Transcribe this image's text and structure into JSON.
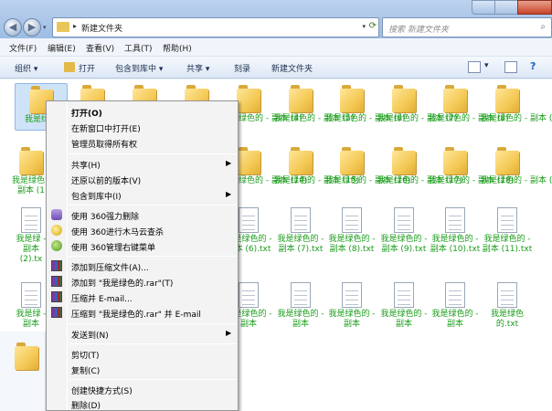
{
  "address": {
    "path": "新建文件夹",
    "search_placeholder": "搜索 新建文件夹"
  },
  "menubar": [
    "文件(F)",
    "编辑(E)",
    "查看(V)",
    "工具(T)",
    "帮助(H)"
  ],
  "toolbar": {
    "organize": "组织 ▾",
    "open": "打开",
    "include": "包含到库中 ▾",
    "share": "共享 ▾",
    "burn": "刻录",
    "new_folder": "新建文件夹"
  },
  "files": {
    "row1_folders": [
      "我是绿色",
      "我是绿色的 - 副本 (4)",
      "我是绿色的 - 副本 (5)",
      "我是绿色的 - 副本 (6)",
      "我是绿色的 - 副本 (7)",
      "我是绿色的 - 副本 (8)",
      "我是绿色的 - 副本 (9)"
    ],
    "row2_folders": [
      "我是绿色 - 副本 (1",
      "我是绿色的 - 副本 (14)",
      "我是绿色的 - 副本 (15)",
      "我是绿色的 - 副本 (16)",
      "我是绿色的 - 副本 (17)",
      "我是绿色的 - 副本 (18)",
      "我是绿色的 - 副本 (19)"
    ],
    "row3_txt": [
      "我是绿 - 副本 (2).tx",
      "我是绿色的 - 副本 (6).txt",
      "我是绿色的 - 副本 (7).txt",
      "我是绿色的 - 副本 (8).txt",
      "我是绿色的 - 副本 (9).txt",
      "我是绿色的 - 副本 (10).txt",
      "我是绿色的 - 副本 (11).txt"
    ],
    "row4_txt": [
      "我是绿 - 副本",
      "我是绿色的 - 副本",
      "我是绿色的 - 副本",
      "我是绿色的 - 副本",
      "我是绿色的 - 副本",
      "我是绿色的 - 副本",
      "我是绿色 的.txt"
    ]
  },
  "context_menu": {
    "open": "打开(O)",
    "open_new_window": "在新窗口中打开(E)",
    "take_ownership": "管理员取得所有权",
    "share": "共享(H)",
    "restore": "还原以前的版本(V)",
    "include_library": "包含到库中(I)",
    "del360": "使用 360强力删除",
    "scan360": "使用 360进行木马云查杀",
    "menu360": "使用 360管理右键菜单",
    "add_archive": "添加到压缩文件(A)...",
    "add_rar": "添加到 \"我是绿色的.rar\"(T)",
    "compress_email": "压缩并 E-mail...",
    "compress_rar_email": "压缩到 \"我是绿色的.rar\" 并 E-mail",
    "send_to": "发送到(N)",
    "cut": "剪切(T)",
    "copy": "复制(C)",
    "create_shortcut": "创建快捷方式(S)",
    "delete": "删除(D)"
  }
}
